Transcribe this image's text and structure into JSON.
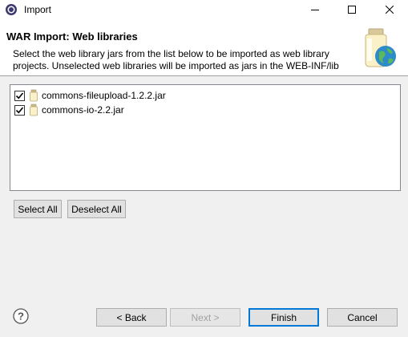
{
  "window": {
    "title": "Import"
  },
  "wizard": {
    "title": "WAR Import: Web libraries",
    "description": "Select the web library jars from the list below to be imported as web library projects.  Unselected web libraries will be imported as jars in the WEB-INF/lib"
  },
  "libraries": [
    {
      "name": "commons-fileupload-1.2.2.jar",
      "checked": true
    },
    {
      "name": "commons-io-2.2.jar",
      "checked": true
    }
  ],
  "buttons": {
    "select_all": "Select All",
    "deselect_all": "Deselect All",
    "back": "< Back",
    "next": "Next >",
    "finish": "Finish",
    "cancel": "Cancel"
  },
  "icons": {
    "app": "eclipse-app-icon",
    "minimize": "minimize-icon",
    "maximize": "maximize-icon",
    "close": "close-icon",
    "wizard": "jar-globe-icon",
    "help": "help-icon"
  }
}
